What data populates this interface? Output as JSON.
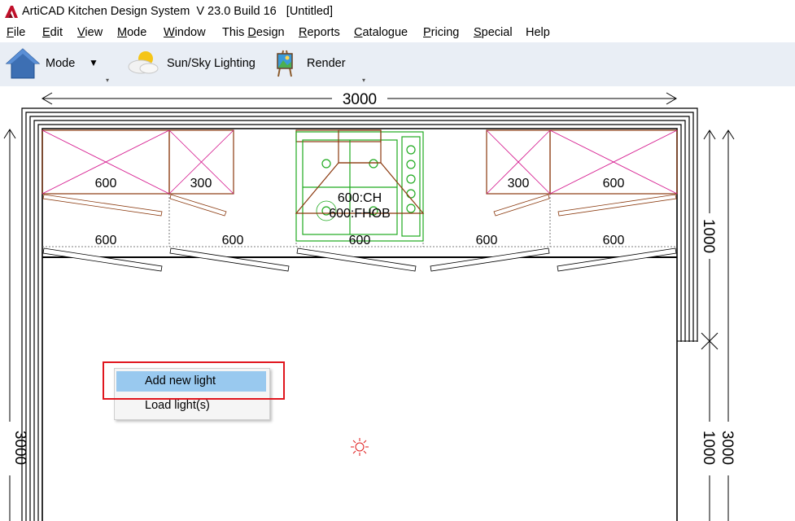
{
  "app": {
    "title": "ArtiCAD Kitchen Design System  V 23.0 Build 16   [Untitled]"
  },
  "menu": [
    {
      "label": "File",
      "underline": "F",
      "rest": "ile"
    },
    {
      "label": "Edit",
      "underline": "E",
      "rest": "dit"
    },
    {
      "label": "View",
      "underline": "V",
      "rest": "iew"
    },
    {
      "label": "Mode",
      "underline": "M",
      "rest": "ode"
    },
    {
      "label": "Window",
      "underline": "W",
      "rest": "indow"
    },
    {
      "label": "This Design",
      "pre": "This ",
      "underline": "D",
      "rest": "esign"
    },
    {
      "label": "Reports",
      "underline": "R",
      "rest": "eports"
    },
    {
      "label": "Catalogue",
      "underline": "C",
      "rest": "atalogue"
    },
    {
      "label": "Pricing",
      "underline": "P",
      "rest": "ricing"
    },
    {
      "label": "Special",
      "underline": "S",
      "rest": "pecial"
    },
    {
      "label": "Help",
      "underline": "",
      "rest": "Help"
    }
  ],
  "toolbar": {
    "mode_label": "Mode",
    "lighting_label": "Sun/Sky Lighting",
    "render_label": "Render",
    "dropdown_glyph": "▼",
    "overflow_glyph": "▾"
  },
  "plan": {
    "room_width_label": "3000",
    "room_depth_label": "3000",
    "wall_cabinet_labels": [
      "600",
      "300",
      "300",
      "600"
    ],
    "chimney_hood_label": "600:CH",
    "hob_label": "600:FHOB",
    "base_cabinet_labels": [
      "600",
      "600",
      "600",
      "600",
      "600"
    ],
    "right_dim_top": "1000",
    "right_dim_mid": "1000",
    "right_dim_total": "3000",
    "colors": {
      "wall": "#000000",
      "wall_cabinet": "#8b3a0f",
      "cross": "#d4148c",
      "appliance": "#1faa1f",
      "light": "#e01a1a"
    }
  },
  "context_menu": {
    "items": [
      "Add new light",
      "Load light(s)"
    ],
    "highlighted": "Add new light"
  }
}
